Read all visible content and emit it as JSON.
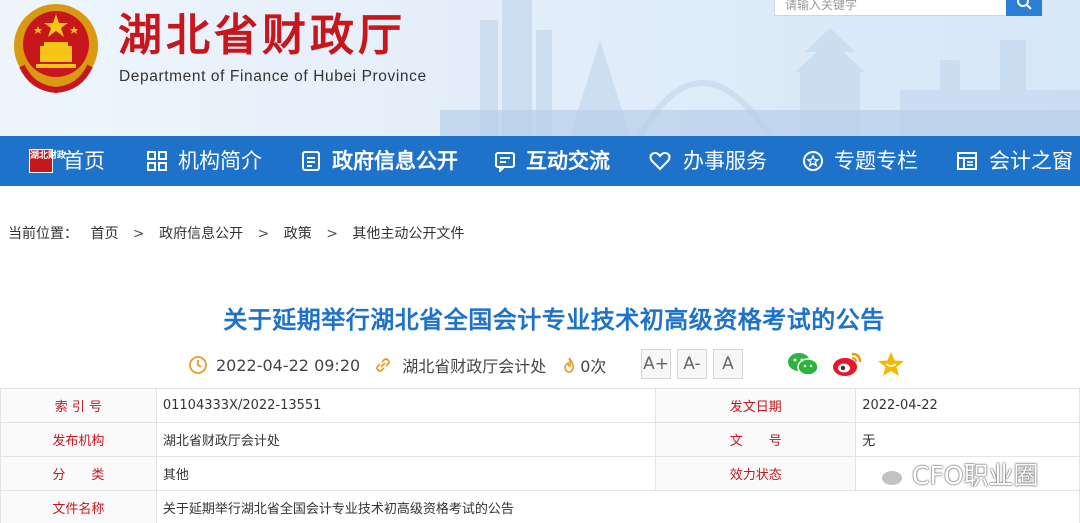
{
  "header": {
    "title": "湖北省财政厅",
    "subtitle": "Department of Finance of Hubei Province",
    "search_placeholder": "请输入关键字"
  },
  "nav": {
    "logo_text": "湖北财政",
    "items": [
      {
        "label": "首页",
        "icon": "home-logo-icon"
      },
      {
        "label": "机构简介",
        "icon": "grid-icon"
      },
      {
        "label": "政府信息公开",
        "icon": "document-list-icon"
      },
      {
        "label": "互动交流",
        "icon": "chat-icon"
      },
      {
        "label": "办事服务",
        "icon": "heart-icon"
      },
      {
        "label": "专题专栏",
        "icon": "star-circle-icon"
      },
      {
        "label": "会计之窗",
        "icon": "chart-window-icon"
      }
    ]
  },
  "breadcrumb": {
    "prefix": "当前位置：",
    "items": [
      "首页",
      "政府信息公开",
      "政策",
      "其他主动公开文件"
    ],
    "separator": ">"
  },
  "article": {
    "title": "关于延期举行湖北省全国会计专业技术初高级资格考试的公告",
    "datetime": "2022-04-22 09:20",
    "source": "湖北省财政厅会计处",
    "views": "0次",
    "font_buttons": [
      "A+",
      "A-",
      "A"
    ],
    "share_icons": [
      "wechat-icon",
      "weibo-icon",
      "favorite-star-icon"
    ]
  },
  "info_table": {
    "rows": [
      {
        "label1": "索 引 号",
        "value1": "01104333X/2022-13551",
        "label2": "发文日期",
        "value2": "2022-04-22"
      },
      {
        "label1": "发布机构",
        "value1": "湖北省财政厅会计处",
        "label2": "文　　号",
        "value2": "无"
      },
      {
        "label1": "分　　类",
        "value1": "其他",
        "label2": "效力状态",
        "value2": ""
      },
      {
        "label1": "文件名称",
        "value1": "关于延期举行湖北省全国会计专业技术初高级资格考试的公告"
      }
    ]
  },
  "watermark": "CFO职业圈",
  "colors": {
    "brand_red": "#c8161d",
    "nav_blue": "#1f72c9",
    "title_blue": "#1f72c9"
  }
}
